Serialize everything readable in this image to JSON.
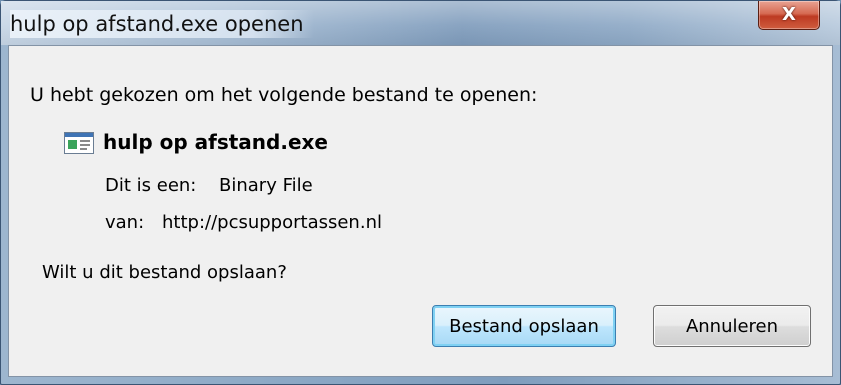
{
  "window": {
    "title": "hulp op afstand.exe openen",
    "close_label": "X"
  },
  "dialog": {
    "prompt": "U hebt gekozen om het volgende bestand te openen:",
    "file_icon": "application-window-icon",
    "file_name": "hulp op afstand.exe",
    "type_label": "Dit is een:",
    "type_value": "Binary File",
    "from_label": "van:",
    "from_value": "http://pcsupportassen.nl",
    "question": "Wilt u dit bestand opslaan?"
  },
  "buttons": {
    "save": "Bestand opslaan",
    "cancel": "Annuleren"
  },
  "colors": {
    "close_button": "#c9442a",
    "default_button_border": "#3c7fb1",
    "client_background": "#f0f0f0"
  }
}
